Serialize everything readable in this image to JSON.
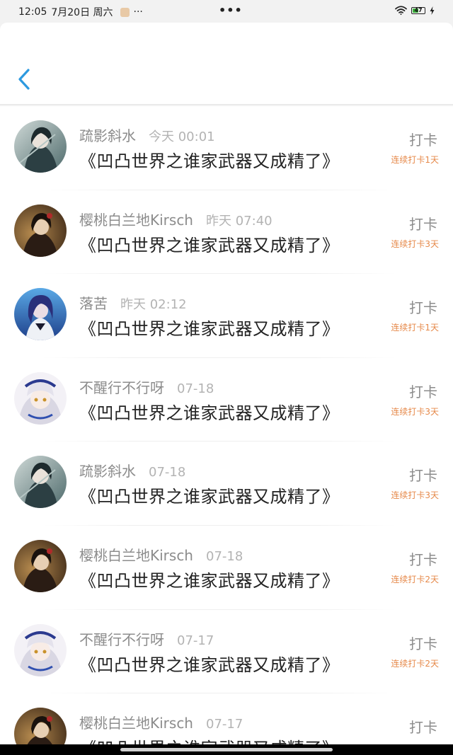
{
  "status_bar": {
    "time": "12:05",
    "date": "7月20日 周六",
    "more": "···",
    "center_dots": "•••",
    "battery_level": "47"
  },
  "header": {
    "back_icon": "chevron-left-icon",
    "accent": "#2d9ae0"
  },
  "items": [
    {
      "name": "疏影斜水",
      "time": "今天 00:01",
      "title": "《凹凸世界之谁家武器又成精了》",
      "type": "打卡",
      "streak": "连续打卡1天",
      "avatar": "ink"
    },
    {
      "name": "樱桃白兰地Kirsch",
      "time": "昨天 07:40",
      "title": "《凹凸世界之谁家武器又成精了》",
      "type": "打卡",
      "streak": "连续打卡3天",
      "avatar": "brown"
    },
    {
      "name": "落苦",
      "time": "昨天 02:12",
      "title": "《凹凸世界之谁家武器又成精了》",
      "type": "打卡",
      "streak": "连续打卡1天",
      "avatar": "blue"
    },
    {
      "name": "不醒行不行呀",
      "time": "07-18",
      "title": "《凹凸世界之谁家武器又成精了》",
      "type": "打卡",
      "streak": "连续打卡3天",
      "avatar": "maid"
    },
    {
      "name": "疏影斜水",
      "time": "07-18",
      "title": "《凹凸世界之谁家武器又成精了》",
      "type": "打卡",
      "streak": "连续打卡3天",
      "avatar": "ink"
    },
    {
      "name": "樱桃白兰地Kirsch",
      "time": "07-18",
      "title": "《凹凸世界之谁家武器又成精了》",
      "type": "打卡",
      "streak": "连续打卡2天",
      "avatar": "brown"
    },
    {
      "name": "不醒行不行呀",
      "time": "07-17",
      "title": "《凹凸世界之谁家武器又成精了》",
      "type": "打卡",
      "streak": "连续打卡2天",
      "avatar": "maid"
    },
    {
      "name": "樱桃白兰地Kirsch",
      "time": "07-17",
      "title": "《凹凸世界之谁家武器又成精了》",
      "type": "打卡",
      "streak": "",
      "avatar": "brown"
    }
  ],
  "colors": {
    "streak": "#e6894a",
    "name": "#8c8c8c",
    "title": "#222222"
  }
}
